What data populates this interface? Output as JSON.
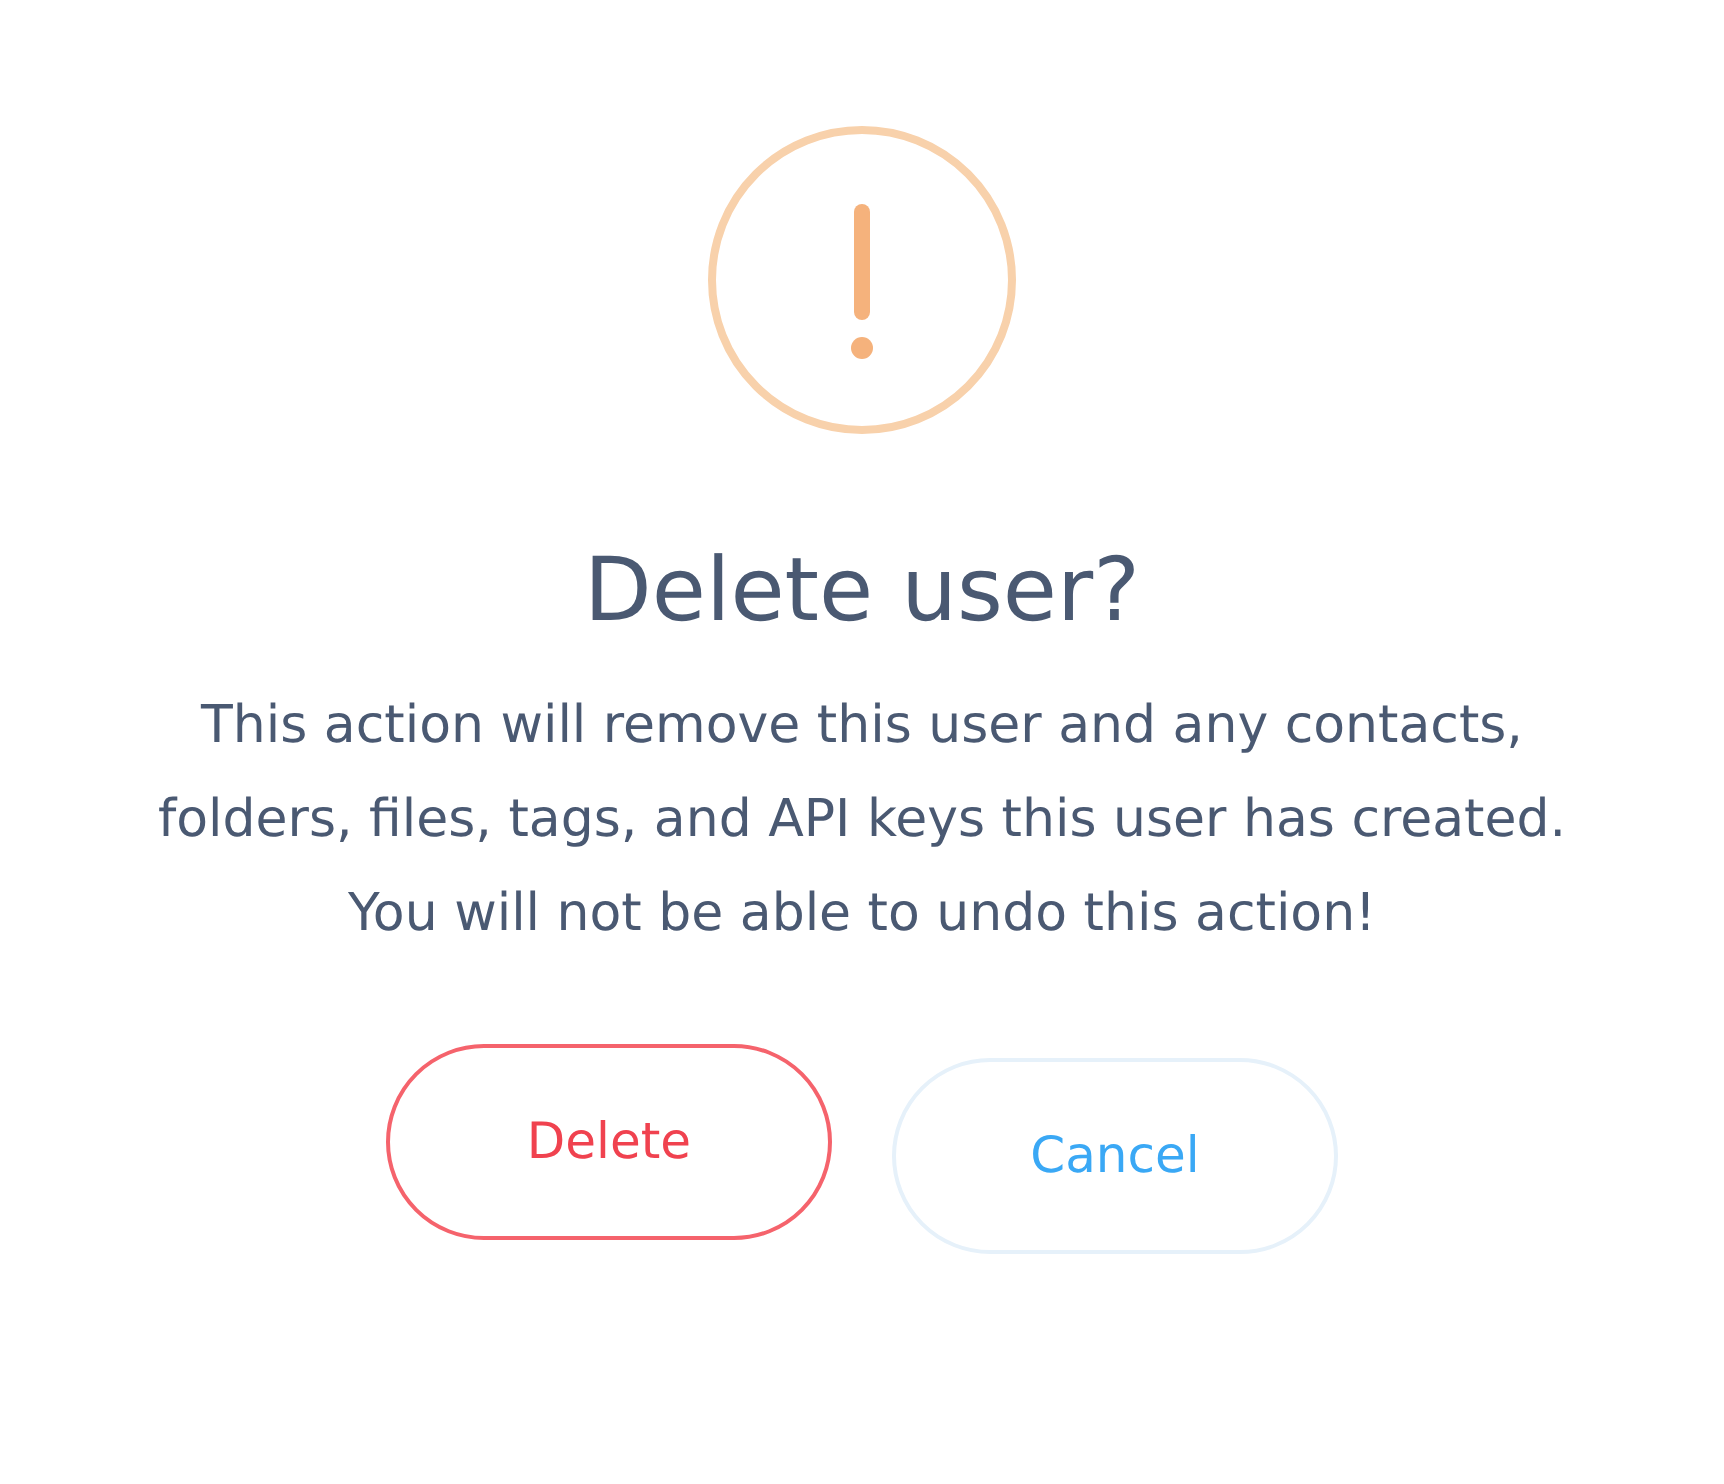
{
  "dialog": {
    "title": "Delete user?",
    "message": "This action will remove this user and any contacts, folders, files, tags, and API keys this user has created. You will not be able to undo this action!",
    "buttons": [
      {
        "label": "Delete",
        "kind": "danger"
      },
      {
        "label": "Cancel",
        "kind": "cancel"
      }
    ]
  }
}
